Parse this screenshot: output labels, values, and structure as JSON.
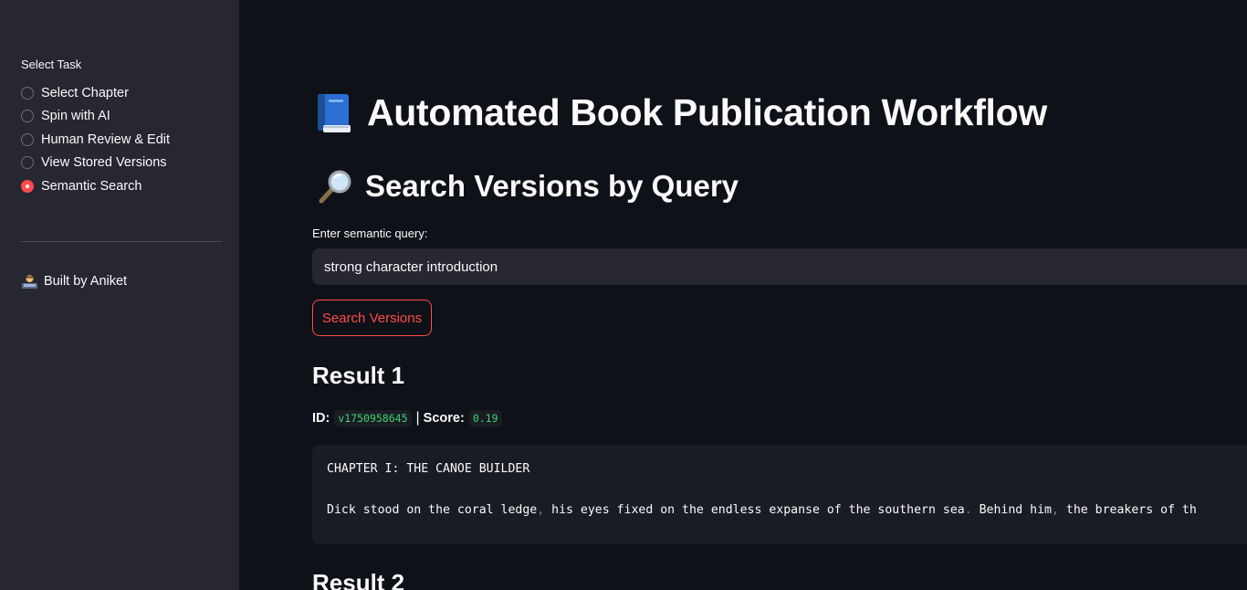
{
  "sidebar": {
    "label": "Select Task",
    "options": [
      {
        "label": "Select Chapter",
        "selected": false
      },
      {
        "label": "Spin with AI",
        "selected": false
      },
      {
        "label": "Human Review & Edit",
        "selected": false
      },
      {
        "label": "View Stored Versions",
        "selected": false
      },
      {
        "label": "Semantic Search",
        "selected": true
      }
    ],
    "footer": {
      "icon": "technologist-icon",
      "text": "Built by Aniket"
    }
  },
  "main": {
    "title": {
      "icon": "blue-book-icon",
      "text": "Automated Book Publication Workflow"
    },
    "section": {
      "icon": "magnifying-glass-icon",
      "text": "Search Versions by Query"
    },
    "query": {
      "label": "Enter semantic query:",
      "value": "strong character introduction"
    },
    "search_button_label": "Search Versions",
    "results": [
      {
        "heading": "Result 1",
        "id_label": "ID:",
        "id_value": "v1750958645",
        "separator": "|",
        "score_label": "Score:",
        "score_value": "0.19",
        "content_line1": "CHAPTER I: THE CANOE BUILDER",
        "content_line2_a": "Dick stood on the coral ledge",
        "content_line2_b": " his eyes fixed on the endless expanse of the southern sea",
        "content_line2_c": " Behind him",
        "content_line2_d": " the breakers of th"
      },
      {
        "heading": "Result 2"
      }
    ]
  },
  "colors": {
    "background": "#0e1117",
    "sidebar": "#262730",
    "accent": "#ff4b4b",
    "code_green": "#3dd56d"
  }
}
